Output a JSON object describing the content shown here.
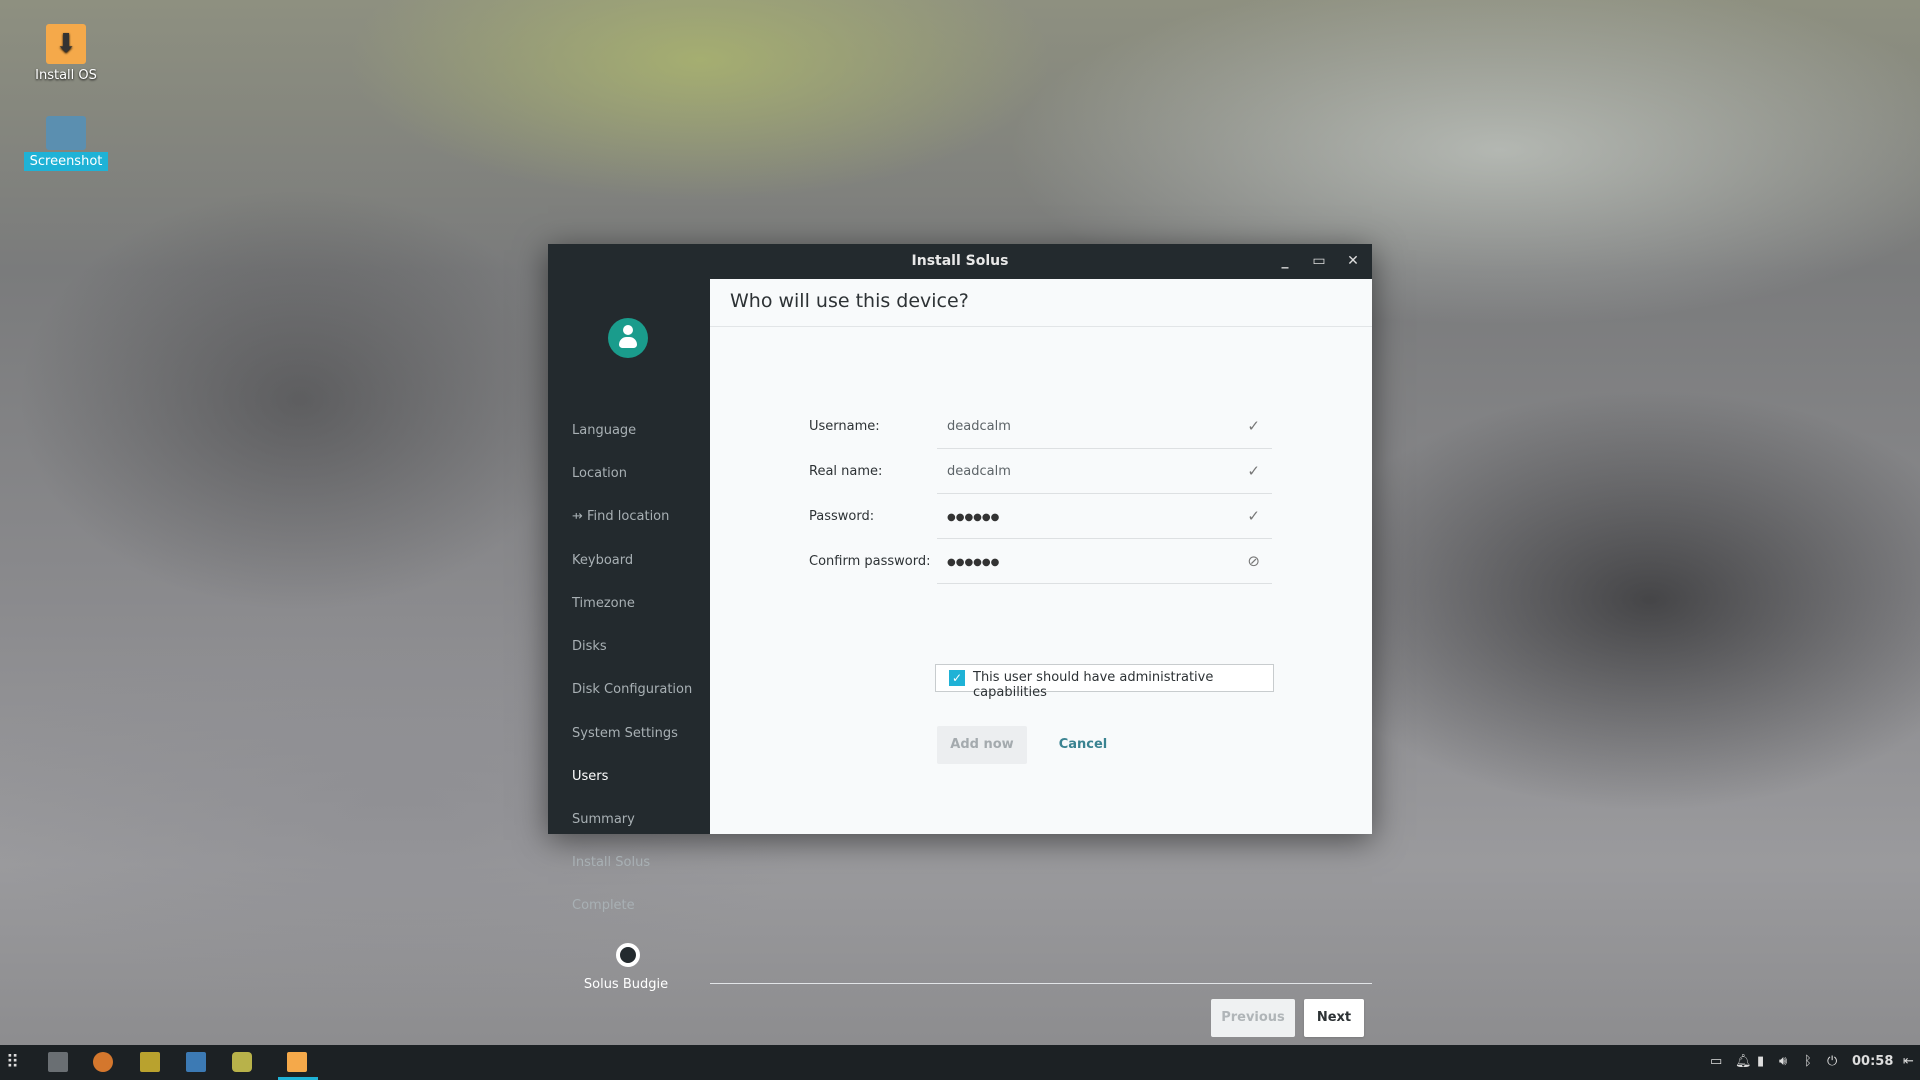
{
  "desktop": {
    "icons": [
      {
        "label": "Install OS",
        "icon": "download-icon",
        "color": "#f5a94a"
      },
      {
        "label": "Screenshot",
        "icon": "screenshot-icon",
        "color": "#5b8fb0"
      }
    ]
  },
  "window": {
    "title": "Install Solus",
    "controls": [
      "minimize",
      "maximize",
      "close"
    ]
  },
  "sidebar": {
    "items": [
      {
        "label": "Language"
      },
      {
        "label": "Location"
      },
      {
        "label": "⇸ Find location"
      },
      {
        "label": "Keyboard"
      },
      {
        "label": "Timezone"
      },
      {
        "label": "Disks"
      },
      {
        "label": "Disk Configuration"
      },
      {
        "label": "System Settings"
      },
      {
        "label": "Users",
        "active": true
      },
      {
        "label": "Summary"
      },
      {
        "label": "Install Solus"
      },
      {
        "label": "Complete"
      }
    ],
    "footer": "Solus Budgie"
  },
  "page": {
    "title": "Who will use this device?",
    "fields": [
      {
        "label": "Username:",
        "value": "deadcalm",
        "status": "✓"
      },
      {
        "label": "Real name:",
        "value": "deadcalm",
        "status": "✓"
      },
      {
        "label": "Password:",
        "value": "●●●●●●",
        "status": "✓"
      },
      {
        "label": "Confirm password:",
        "value": "●●●●●●",
        "status": "⊘"
      }
    ],
    "admin_checkbox": {
      "label": "This user should have administrative capabilities",
      "checked": true
    },
    "add_now": "Add now",
    "cancel": "Cancel",
    "previous": "Previous",
    "next": "Next"
  },
  "taskbar": {
    "clock": "00:58",
    "accent": "#1fb2d6"
  }
}
